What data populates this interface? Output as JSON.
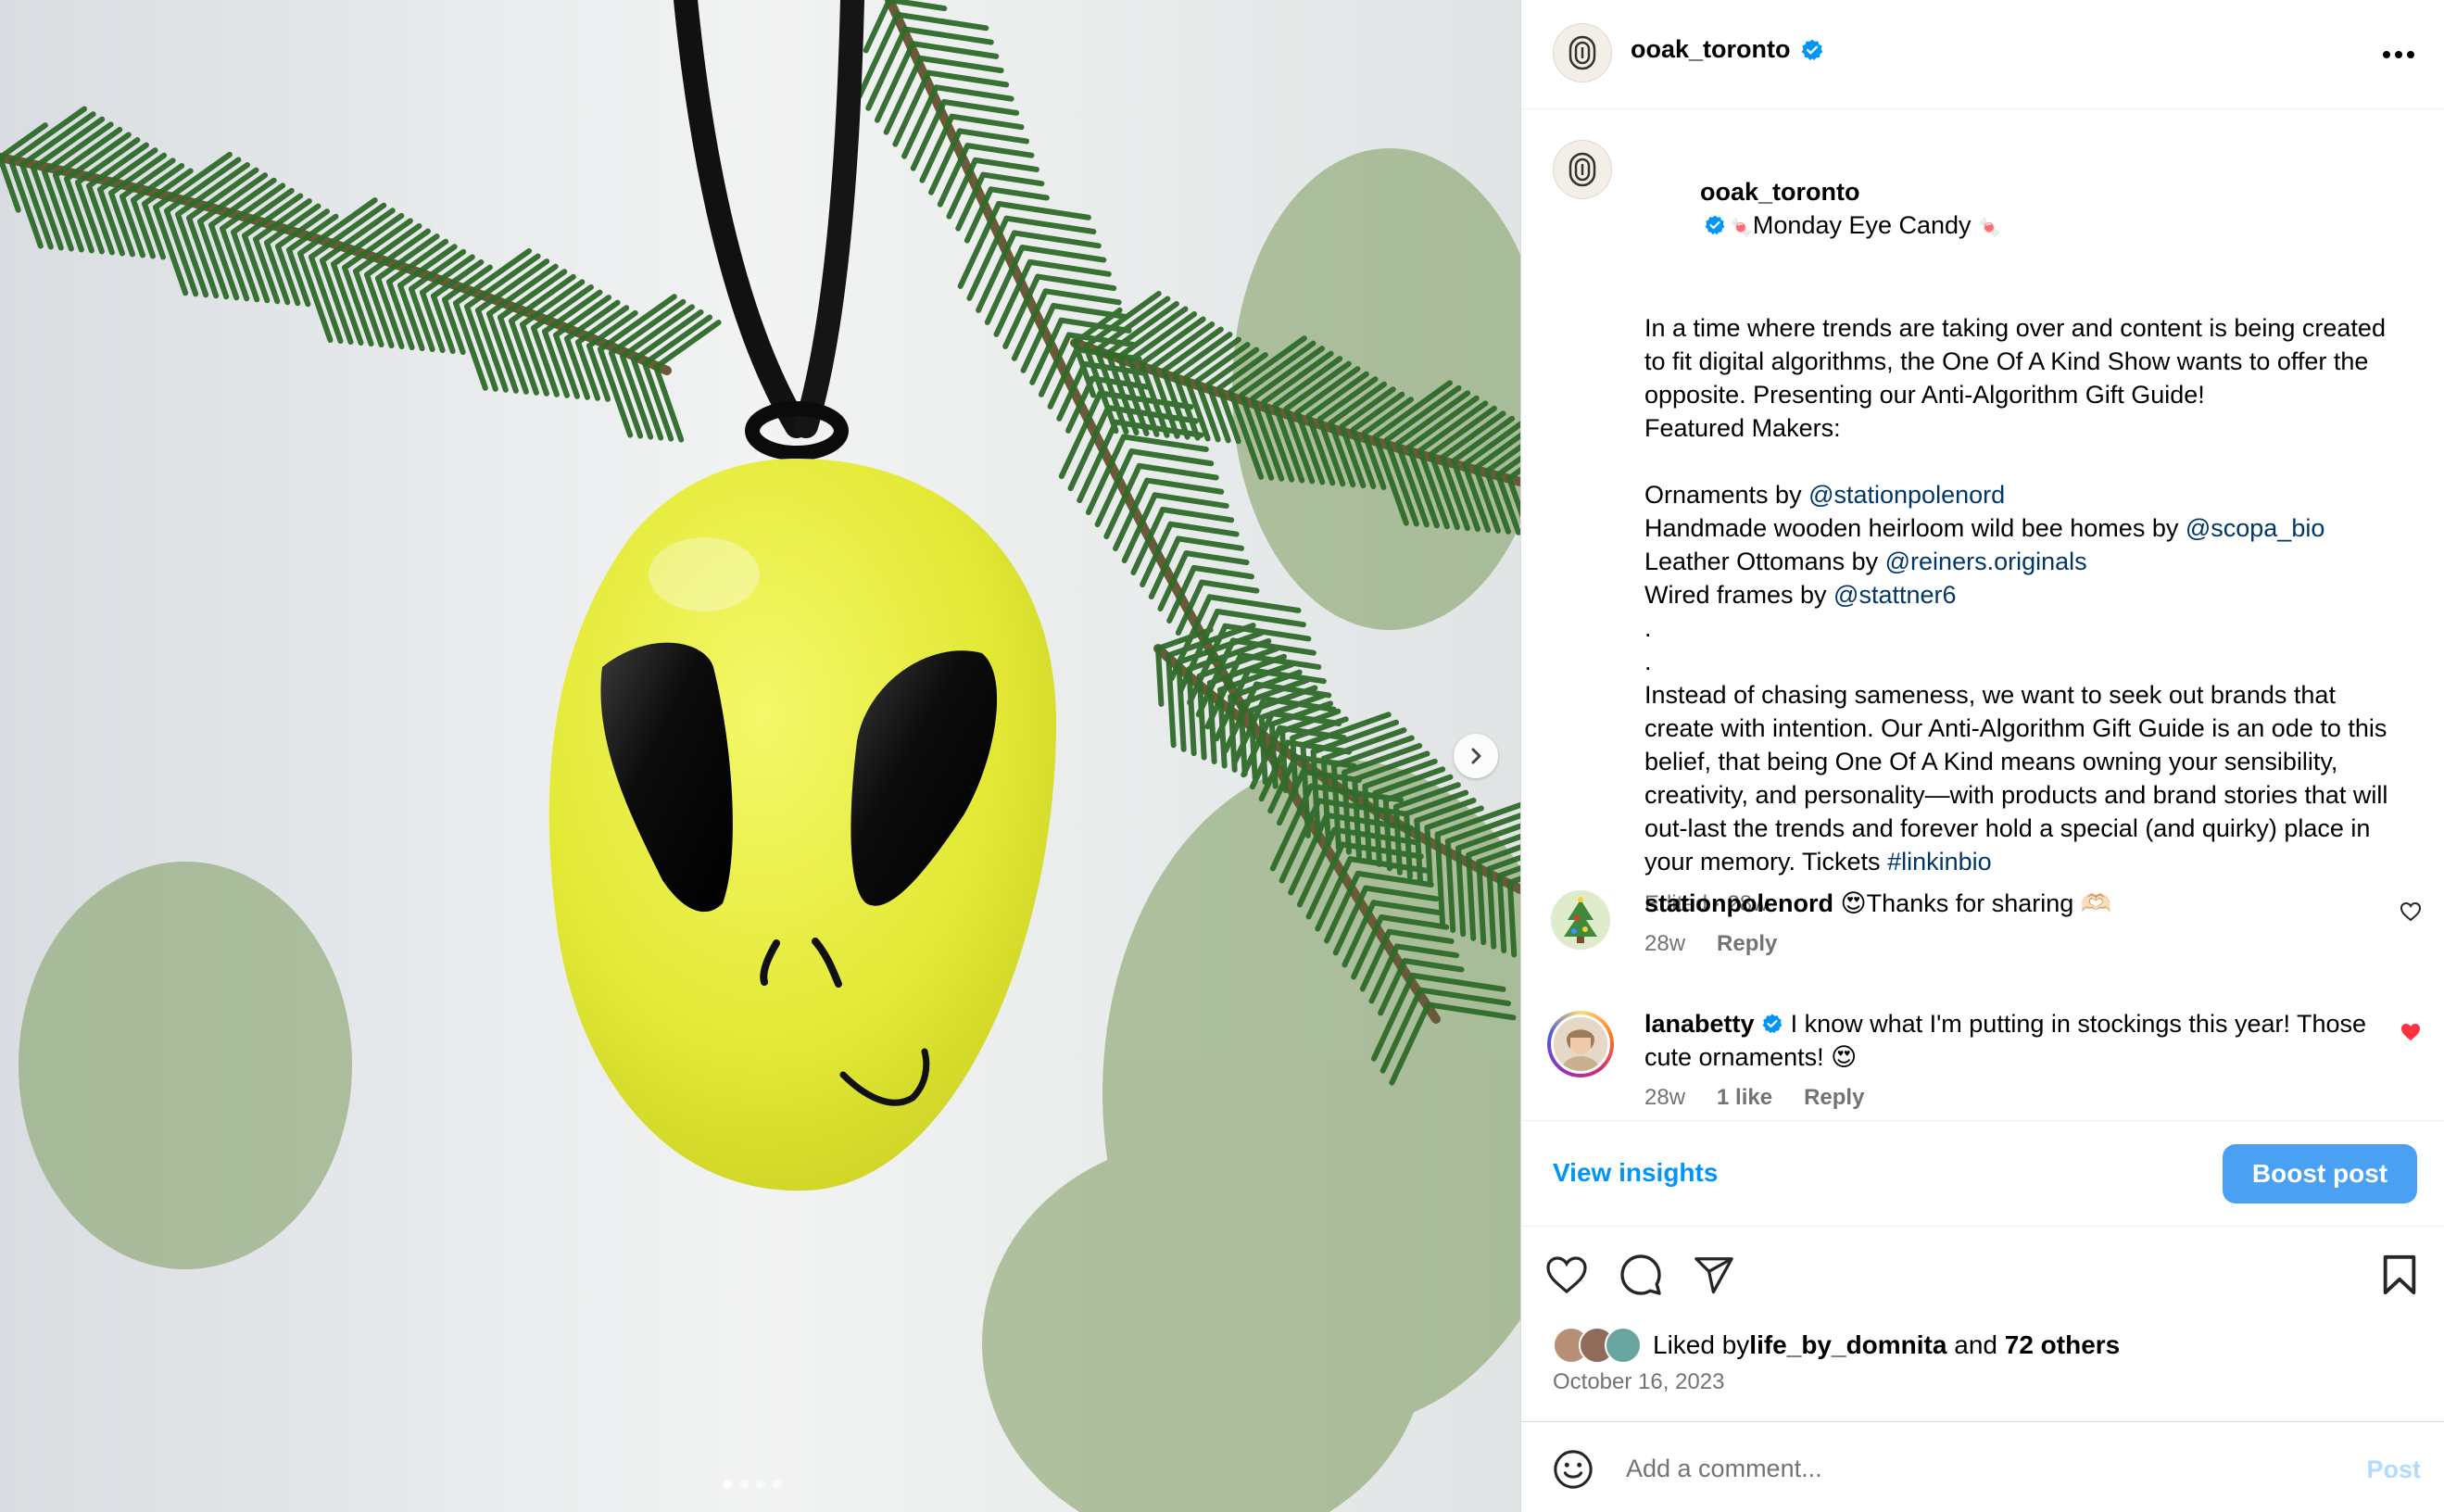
{
  "colors": {
    "link": "#00376b",
    "primary_button": "#4aa1f3",
    "accent_text": "#0095f6",
    "muted": "#737373",
    "verified": "#0095f6",
    "liked_heart": "#ff3040"
  },
  "media": {
    "image_subject": "yellow alien face glass ornament on pine branch",
    "next_icon": "chevron-right-icon",
    "carousel_count": 4,
    "carousel_active_index": 0
  },
  "header": {
    "username": "ooak_toronto",
    "verified_icon": "verified-badge-icon",
    "more_icon": "more-horizontal-icon"
  },
  "caption": {
    "username": "ooak_toronto",
    "headline": "Monday Eye Candy",
    "headline_emoji": "🍬",
    "para1": "In a time where trends are taking over and content is being created to fit digital algorithms, the One Of A Kind Show wants to offer the opposite. Presenting our Anti-Algorithm Gift Guide!",
    "featured": "Featured Makers:",
    "makers": [
      {
        "text": "Ornaments by ",
        "mention": "@stationpolenord"
      },
      {
        "text": "Handmade wooden heirloom wild bee homes by ",
        "mention": "@scopa_bio"
      },
      {
        "text": "Leather Ottomans by ",
        "mention": "@reiners.originals"
      },
      {
        "text": "Wired frames by ",
        "mention": "@stattner6"
      }
    ],
    "dot1": ".",
    "dot2": ".",
    "para2": "Instead of chasing sameness, we want to seek out brands that create with intention. Our Anti-Algorithm Gift Guide is an ode to this belief, that being One Of A Kind means owning your sensibility, creativity, and personality—with products and brand stories that will out-last the trends and forever hold a special (and quirky) place in your memory. Tickets ",
    "hashtag": "#linkinbio",
    "meta": "Edited · 28w"
  },
  "comments": [
    {
      "username": "stationpolenord",
      "text": "😍Thanks for sharing 🫶🏻",
      "time": "28w",
      "likes": "",
      "reply": "Reply",
      "liked": false
    },
    {
      "username": "lanabetty",
      "text": "I know what I'm putting in stockings this year! Those cute ornaments! 😍",
      "time": "28w",
      "likes": "1 like",
      "reply": "Reply",
      "liked": true
    }
  ],
  "insights": {
    "view_label": "View insights",
    "boost_label": "Boost post"
  },
  "actions": {
    "like_icon": "heart-icon",
    "comment_icon": "comment-icon",
    "share_icon": "send-icon",
    "save_icon": "bookmark-icon"
  },
  "likes": {
    "prefix": "Liked by ",
    "user": "life_by_domnita",
    "middle": " and ",
    "others": "72 others"
  },
  "post_date": "October 16, 2023",
  "comment_box": {
    "placeholder": "Add a comment...",
    "post_label": "Post",
    "emoji_icon": "emoji-icon"
  }
}
